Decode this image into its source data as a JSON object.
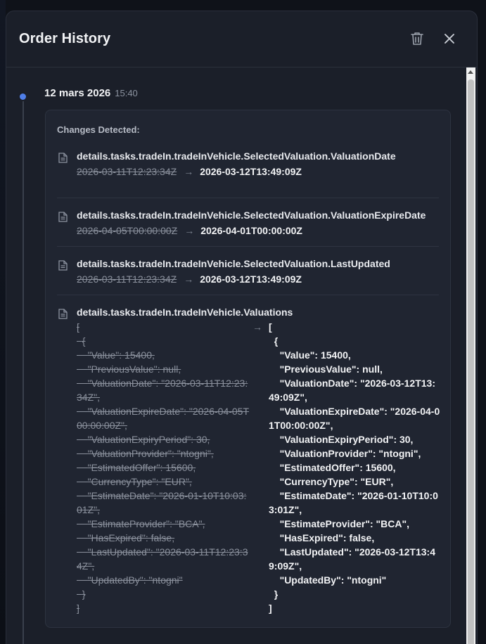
{
  "header": {
    "title": "Order History"
  },
  "entry": {
    "date": "12 mars 2026",
    "time": "15:40",
    "heading": "Changes Detected:",
    "changes": [
      {
        "field": "details.tasks.tradeIn.tradeInVehicle.SelectedValuation.ValuationDate",
        "old": "2026-03-11T12:23:34Z",
        "new": "2026-03-12T13:49:09Z"
      },
      {
        "field": "details.tasks.tradeIn.tradeInVehicle.SelectedValuation.ValuationExpireDate",
        "old": "2026-04-05T00:00:00Z",
        "new": "2026-04-01T00:00:00Z"
      },
      {
        "field": "details.tasks.tradeIn.tradeInVehicle.SelectedValuation.LastUpdated",
        "old": "2026-03-11T12:23:34Z",
        "new": "2026-03-12T13:49:09Z"
      }
    ],
    "valuations": {
      "field": "details.tasks.tradeIn.tradeInVehicle.Valuations",
      "old": "[\n  {\n    \"Value\": 15400,\n    \"PreviousValue\": null,\n    \"ValuationDate\": \"2026-03-11T12:23:34Z\",\n    \"ValuationExpireDate\": \"2026-04-05T00:00:00Z\",\n    \"ValuationExpiryPeriod\": 30,\n    \"ValuationProvider\": \"ntogni\",\n    \"EstimatedOffer\": 15600,\n    \"CurrencyType\": \"EUR\",\n    \"EstimateDate\": \"2026-01-10T10:03:01Z\",\n    \"EstimateProvider\": \"BCA\",\n    \"HasExpired\": false,\n    \"LastUpdated\": \"2026-03-11T12:23:34Z\",\n    \"UpdatedBy\": \"ntogni\"\n  }\n]",
      "new": "[\n  {\n    \"Value\": 15400,\n    \"PreviousValue\": null,\n    \"ValuationDate\": \"2026-03-12T13:49:09Z\",\n    \"ValuationExpireDate\": \"2026-04-01T00:00:00Z\",\n    \"ValuationExpiryPeriod\": 30,\n    \"ValuationProvider\": \"ntogni\",\n    \"EstimatedOffer\": 15600,\n    \"CurrencyType\": \"EUR\",\n    \"EstimateDate\": \"2026-01-10T10:03:01Z\",\n    \"EstimateProvider\": \"BCA\",\n    \"HasExpired\": false,\n    \"LastUpdated\": \"2026-03-12T13:49:09Z\",\n    \"UpdatedBy\": \"ntogni\"\n  }\n]"
    }
  },
  "colors": {
    "accent": "#4f7ee8",
    "panel": "#1b1f29",
    "card": "#202531"
  },
  "icons": {
    "delete": "trash-icon",
    "close": "close-icon",
    "field": "document-icon",
    "change": "arrow-right-icon"
  }
}
